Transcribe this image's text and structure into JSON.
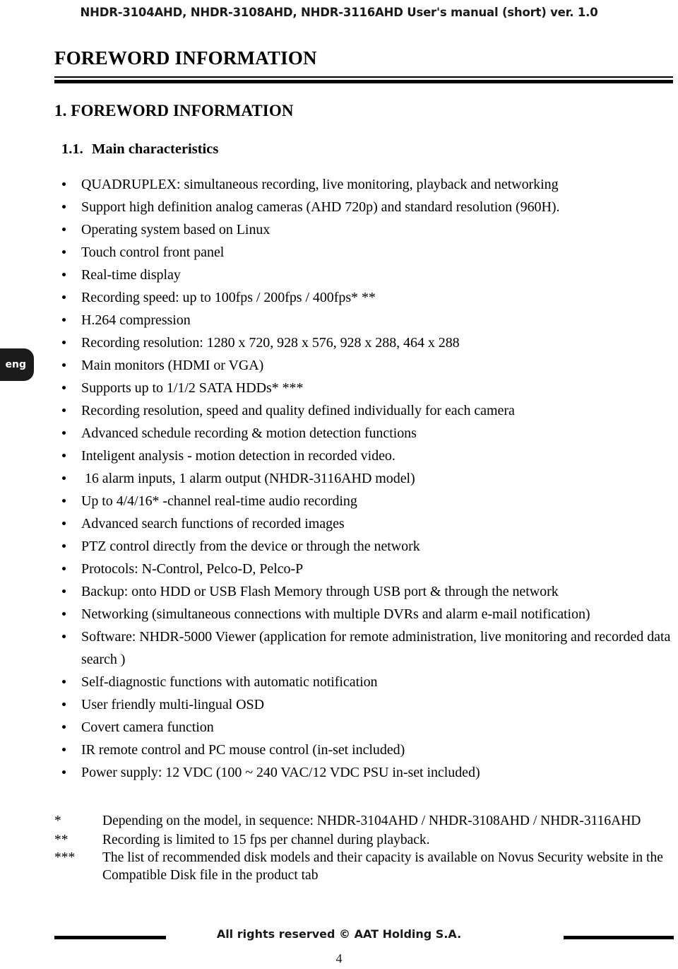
{
  "header": {
    "text": "NHDR-3104AHD, NHDR-3108AHD, NHDR-3116AHD User's manual (short) ver. 1.0"
  },
  "language_tab": {
    "label": "eng"
  },
  "document": {
    "title": "FOREWORD INFORMATION",
    "section_heading": "1. FOREWORD INFORMATION",
    "subsection_number": "1.1.",
    "subsection_title": "Main characteristics"
  },
  "features": [
    "QUADRUPLEX: simultaneous recording, live monitoring, playback and networking",
    "Support high definition analog cameras (AHD 720p) and standard resolution (960H).",
    "Operating system based on Linux",
    "Touch control front panel",
    "Real-time display",
    "Recording speed: up to 100fps / 200fps / 400fps* **",
    "H.264 compression",
    "Recording resolution: 1280 x 720, 928 x 576, 928 x 288, 464 x 288",
    "Main monitors (HDMI or VGA)",
    "Supports up to 1/1/2 SATA HDDs* ***",
    "Recording resolution, speed and quality defined individually for each camera",
    "Advanced schedule recording & motion detection functions",
    "Inteligent analysis - motion detection in recorded video.",
    " 16 alarm inputs, 1 alarm output (NHDR-3116AHD model)",
    "Up to 4/4/16* -channel real-time audio recording",
    "Advanced search functions of recorded images",
    "PTZ control directly from the device or through the network",
    "Protocols: N-Control, Pelco-D, Pelco-P",
    "Backup: onto HDD or USB Flash Memory through USB port & through the network",
    "Networking (simultaneous connections with multiple DVRs and alarm e-mail notification)",
    "Software: NHDR-5000 Viewer (application for remote administration, live monitoring and recorded data search )",
    "Self-diagnostic functions with automatic notification",
    "User friendly multi-lingual OSD",
    "Covert camera function",
    "IR remote control and PC mouse control (in-set included)",
    "Power supply: 12 VDC (100 ~ 240 VAC/12 VDC PSU in-set included)"
  ],
  "footnotes": [
    {
      "mark": "*",
      "text": "Depending on the model, in sequence: NHDR-3104AHD / NHDR-3108AHD / NHDR-3116AHD"
    },
    {
      "mark": "**",
      "text": "Recording is limited to 15 fps per channel during playback."
    },
    {
      "mark": "***",
      "text": "The list of recommended disk models and their capacity is available on Novus Security website in the Compatible Disk file in the product tab"
    }
  ],
  "footer": {
    "copyright": "All rights reserved © AAT Holding S.A.",
    "page_number": "4"
  }
}
